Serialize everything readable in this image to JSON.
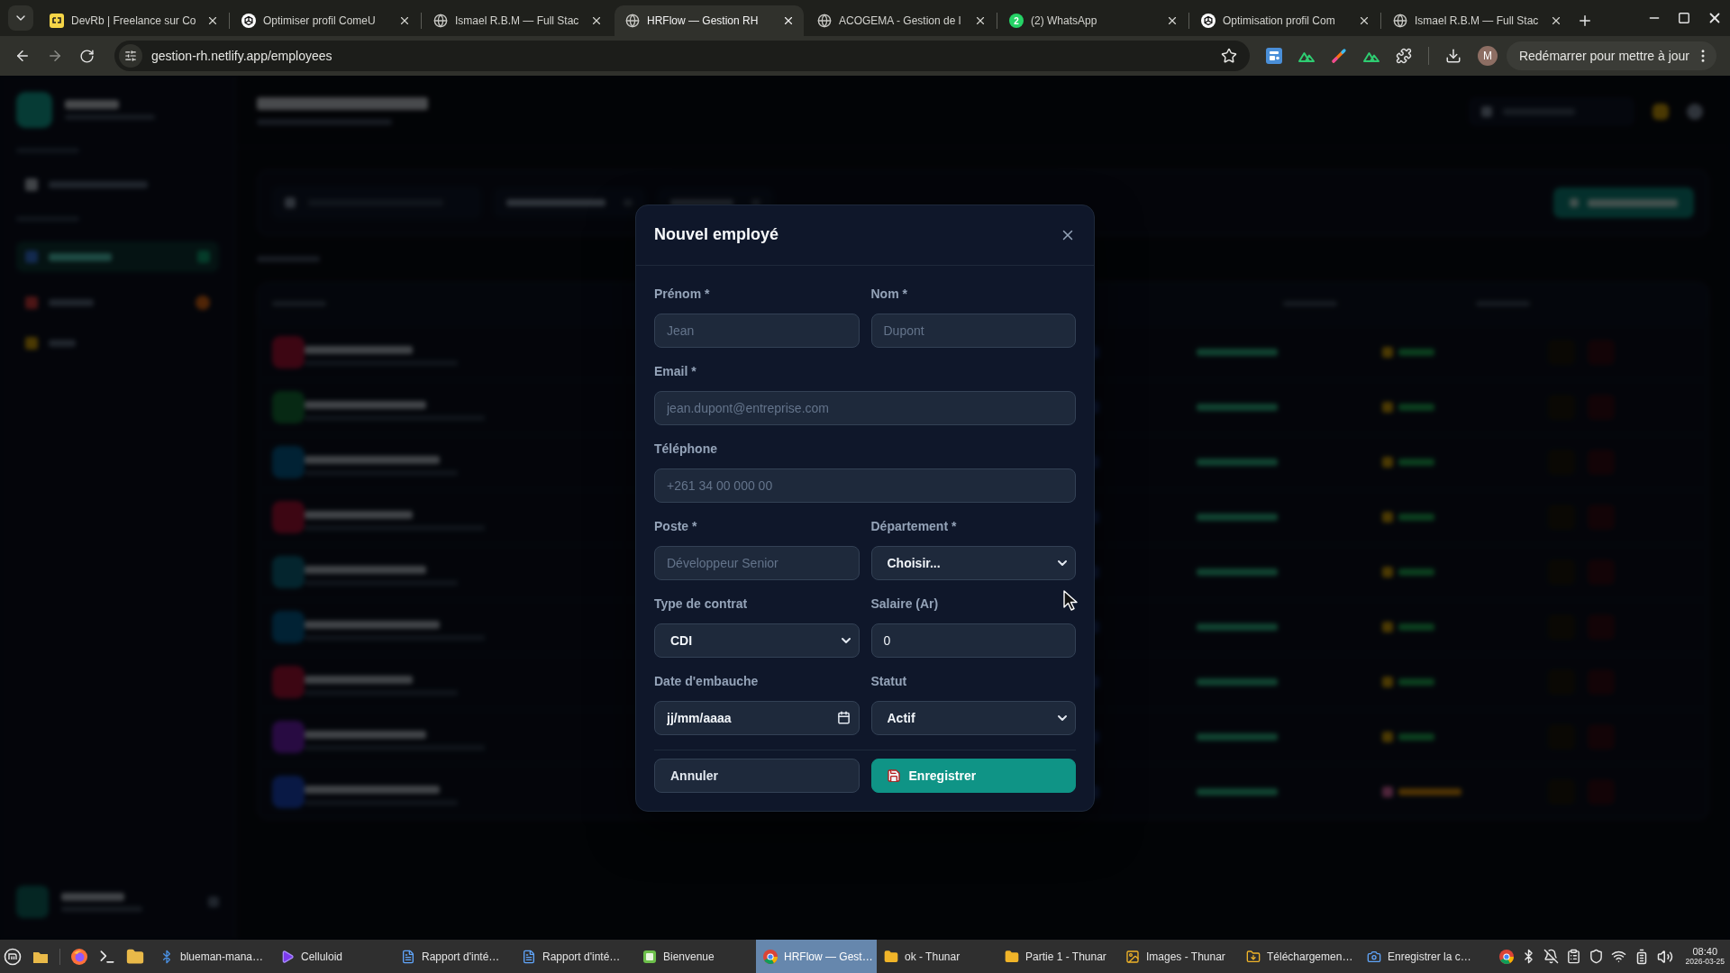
{
  "browser": {
    "tabs": [
      {
        "title": "DevRb | Freelance sur Co",
        "kind": "tile",
        "selected": false
      },
      {
        "title": "Optimiser profil ComeU",
        "kind": "knot",
        "selected": false
      },
      {
        "title": "Ismael R.B.M — Full Stac",
        "kind": "globe",
        "selected": false
      },
      {
        "title": "HRFlow — Gestion RH",
        "kind": "globe",
        "selected": true
      },
      {
        "title": "ACOGEMA - Gestion de l",
        "kind": "globe",
        "selected": false
      },
      {
        "title": "(2) WhatsApp",
        "kind": "badge",
        "badge": "2",
        "selected": false
      },
      {
        "title": "Optimisation profil Com",
        "kind": "knot",
        "selected": false
      },
      {
        "title": "Ismael R.B.M — Full Stac",
        "kind": "globe",
        "selected": false
      }
    ],
    "address": "gestion-rh.netlify.app/employees",
    "profile_initial": "M",
    "update_button": "Redémarrer pour mettre à jour"
  },
  "dialog": {
    "title": "Nouvel employé",
    "rows": [
      [
        {
          "label": "Prénom *",
          "kind": "text",
          "placeholder": "Jean"
        },
        {
          "label": "Nom *",
          "kind": "text",
          "placeholder": "Dupont"
        }
      ],
      [
        {
          "label": "Email *",
          "kind": "text",
          "placeholder": "jean.dupont@entreprise.com"
        }
      ],
      [
        {
          "label": "Téléphone",
          "kind": "text",
          "placeholder": "+261 34 00 000 00"
        }
      ],
      [
        {
          "label": "Poste *",
          "kind": "text",
          "placeholder": "Développeur Senior"
        },
        {
          "label": "Département *",
          "kind": "select",
          "value": "Choisir..."
        }
      ],
      [
        {
          "label": "Type de contrat",
          "kind": "select",
          "value": "CDI"
        },
        {
          "label": "Salaire (Ar)",
          "kind": "number",
          "value": "0"
        }
      ],
      [
        {
          "label": "Date d'embauche",
          "kind": "date",
          "placeholder": "jj/mm/aaaa"
        },
        {
          "label": "Statut",
          "kind": "select",
          "value": "Actif"
        }
      ]
    ],
    "buttons": [
      {
        "label": "Annuler",
        "kind": "secondary"
      },
      {
        "label": "Enregistrer",
        "kind": "primary"
      }
    ]
  },
  "taskbar": {
    "tasks": [
      {
        "title": "blueman-mana…",
        "kind": "bluetooth",
        "selected": false
      },
      {
        "title": "Celluloid",
        "kind": "player",
        "selected": false
      },
      {
        "title": "Rapport d'inté…",
        "kind": "document",
        "selected": false
      },
      {
        "title": "Rapport d'inté…",
        "kind": "document",
        "selected": false
      },
      {
        "title": "Bienvenue",
        "kind": "welcome",
        "selected": false
      },
      {
        "title": "HRFlow — Gest…",
        "kind": "browser",
        "selected": true
      },
      {
        "title": "ok - Thunar",
        "kind": "folder",
        "selected": false
      },
      {
        "title": "Partie 1 - Thunar",
        "kind": "folder",
        "selected": false
      },
      {
        "title": "Images - Thunar",
        "kind": "pictures",
        "selected": false
      },
      {
        "title": "Téléchargemen…",
        "kind": "downloads",
        "selected": false
      },
      {
        "title": "Enregistrer la c…",
        "kind": "screenshot",
        "selected": false
      }
    ],
    "clock": {
      "time": "08:40",
      "date": "2026-03-25"
    }
  }
}
